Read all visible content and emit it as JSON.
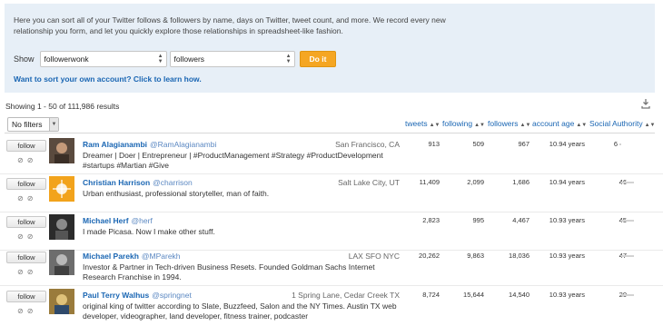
{
  "info": {
    "intro": "Here you can sort all of your Twitter follows & followers by name, days on Twitter, tweet count, and more. We record every new relationship you form, and let you quickly explore those relationships in spreadsheet-like fashion.",
    "show_label": "Show",
    "account_value": "followerwonk",
    "relation_value": "followers",
    "doit_label": "Do it",
    "learn_link": "Want to sort your own account? Click to learn how."
  },
  "results": {
    "showing": "Showing 1 - 50 of 111,986 results",
    "filter_value": "No filters"
  },
  "columns": {
    "tweets": "tweets",
    "following": "following",
    "followers": "followers",
    "account_age": "account age",
    "social_authority": "Social Authority",
    "sort_glyph": "▲▼"
  },
  "follow_label": "follow",
  "rows": [
    {
      "name": "Ram Alagianambi",
      "handle": "@RamAlagianambi",
      "location": "San Francisco, CA",
      "bio": "Dreamer | Doer | Entrepreneur | #ProductManagement #Strategy #ProductDevelopment #startups #Martian #Give",
      "tweets": "913",
      "following": "509",
      "followers": "967",
      "age": "10.94 years",
      "sa": "6",
      "sa_level": 0.06
    },
    {
      "name": "Christian Harrison",
      "handle": "@charrison",
      "location": "Salt Lake City, UT",
      "bio": "Urban enthusiast, professional storyteller, man of faith.",
      "tweets": "11,409",
      "following": "2,099",
      "followers": "1,686",
      "age": "10.94 years",
      "sa": "46",
      "sa_level": 0.46
    },
    {
      "name": "Michael Herf",
      "handle": "@herf",
      "location": "",
      "bio": "I made Picasa. Now I make other stuff.",
      "tweets": "2,823",
      "following": "995",
      "followers": "4,467",
      "age": "10.93 years",
      "sa": "45",
      "sa_level": 0.45
    },
    {
      "name": "Michael Parekh",
      "handle": "@MParekh",
      "location": "LAX SFO NYC",
      "bio": "Investor & Partner in Tech-driven Business Resets. Founded Goldman Sachs Internet Research Franchise in 1994.",
      "tweets": "20,262",
      "following": "9,863",
      "followers": "18,036",
      "age": "10.93 years",
      "sa": "47",
      "sa_level": 0.47
    },
    {
      "name": "Paul Terry Walhus",
      "handle": "@springnet",
      "location": "1 Spring Lane, Cedar Creek TX",
      "bio": "original king of twitter according to Slate, Buzzfeed, Salon and the NY Times. Austin TX web developer, videographer, land developer, fitness trainer, podcaster",
      "tweets": "8,724",
      "following": "15,644",
      "followers": "14,540",
      "age": "10.93 years",
      "sa": "20",
      "sa_level": 0.2
    }
  ],
  "colors": {
    "info_bg": "#e7eff7",
    "link": "#1a66b3",
    "doit": "#f5a623"
  },
  "icons": {
    "download": "download-icon",
    "row_actions": "circle-slash-icon"
  }
}
